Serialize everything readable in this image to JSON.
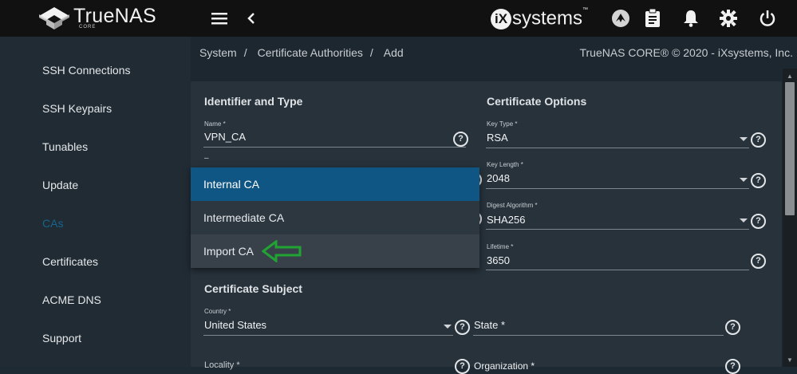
{
  "header": {
    "logo_text": "TrueNAS",
    "logo_sub": "CORE",
    "vendor_mark": "iX",
    "vendor_text": "systems",
    "vendor_tm": "™"
  },
  "sidebar": {
    "items": [
      {
        "label": "SSH Connections"
      },
      {
        "label": "SSH Keypairs"
      },
      {
        "label": "Tunables"
      },
      {
        "label": "Update"
      },
      {
        "label": "CAs"
      },
      {
        "label": "Certificates"
      },
      {
        "label": "ACME DNS"
      },
      {
        "label": "Support"
      }
    ]
  },
  "breadcrumb": {
    "items": [
      "System",
      "/",
      "Certificate Authorities",
      "/",
      "Add"
    ],
    "copyright": "TrueNAS CORE® © 2020 - iXsystems, Inc."
  },
  "form": {
    "identifier_title": "Identifier and Type",
    "name_label": "Name *",
    "name_value": "VPN_CA",
    "type_label": "–",
    "certificate_options_title": "Certificate Options",
    "key_type_label": "Key Type *",
    "key_type_value": "RSA",
    "key_length_label": "Key Length *",
    "key_length_value": "2048",
    "digest_label": "Digest Algorithm *",
    "digest_value": "SHA256",
    "lifetime_label": "Lifetime *",
    "lifetime_value": "3650",
    "subject_title": "Certificate Subject",
    "country_label": "Country *",
    "country_value": "United States",
    "state_label": "State *",
    "locality_label": "Locality *",
    "organization_label": "Organization *",
    "help_glyph": "?"
  },
  "type_dropdown": {
    "options": [
      "Internal CA",
      "Intermediate CA",
      "Import CA"
    ],
    "selected": "Internal CA",
    "hovered": "Import CA"
  },
  "colors": {
    "accent": "#105684",
    "active_sidebar": "#17648e",
    "annotation_arrow": "#21a334"
  }
}
